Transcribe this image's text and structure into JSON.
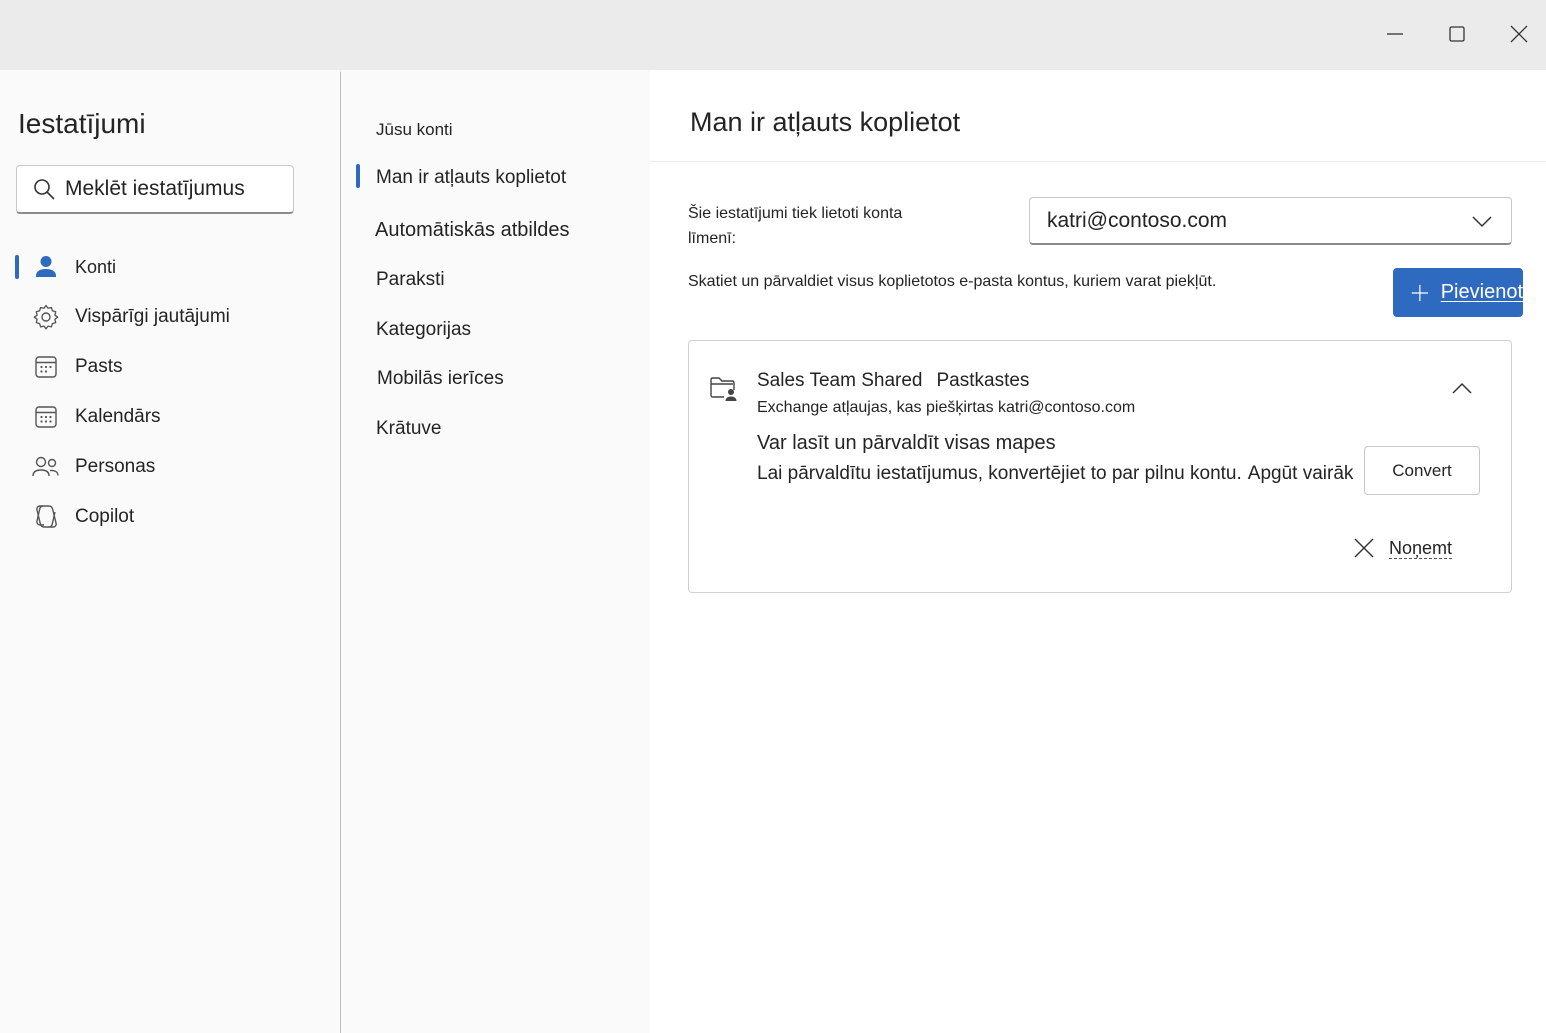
{
  "window": {
    "minimize_icon": "minimize-icon",
    "maximize_icon": "maximize-icon",
    "close_icon": "close-icon"
  },
  "sidebar": {
    "title": "Iestatījumi",
    "search_placeholder": "Meklēt iestatījumus",
    "items": [
      {
        "label": "Konti",
        "icon": "person-icon",
        "selected": true
      },
      {
        "label": "Vispārīgi jautājumi",
        "icon": "gear-icon",
        "selected": false
      },
      {
        "label": "Pasts",
        "icon": "mail-calendar-icon",
        "selected": false
      },
      {
        "label": "Kalendārs",
        "icon": "calendar-icon",
        "selected": false
      },
      {
        "label": "Personas",
        "icon": "people-icon",
        "selected": false
      },
      {
        "label": "Copilot",
        "icon": "copilot-icon",
        "selected": false
      }
    ]
  },
  "subnav": {
    "items": [
      {
        "label": "Jūsu konti",
        "selected": false
      },
      {
        "label": "Man ir atļauts koplietot",
        "selected": true
      },
      {
        "label": "Automātiskās atbildes",
        "selected": false
      },
      {
        "label": "Paraksti",
        "selected": false
      },
      {
        "label": "Kategorijas",
        "selected": false
      },
      {
        "label": "Mobilās ierīces",
        "selected": false
      },
      {
        "label": "Krātuve",
        "selected": false
      }
    ]
  },
  "main": {
    "title": "Man ir atļauts koplietot",
    "apply_label": "Šie iestatījumi tiek lietoti konta līmenī:",
    "account_value": "katri@contoso.com",
    "description": "Skatiet un pārvaldiet visus koplietotos e-pasta kontus, kuriem varat piekļūt.",
    "add_button_label": "Pievienot",
    "card": {
      "name": "Sales Team Shared",
      "type": "Pastkastes",
      "permissions": "Exchange atļaujas, kas piešķirtas katri@contoso.com",
      "access": "Var lasīt un pārvaldīt visas mapes",
      "manage_note": "Lai pārvaldītu iestatījumus, konvertējiet to par pilnu kontu.",
      "learn_more": "Apgūt vairāk",
      "convert_label": "Convert",
      "remove_label": "Noņemt"
    }
  },
  "colors": {
    "accent": "#2f6ac1",
    "titlebar": "#ebebeb",
    "nav_bg": "#fafafa",
    "content_bg": "#ffffff"
  }
}
